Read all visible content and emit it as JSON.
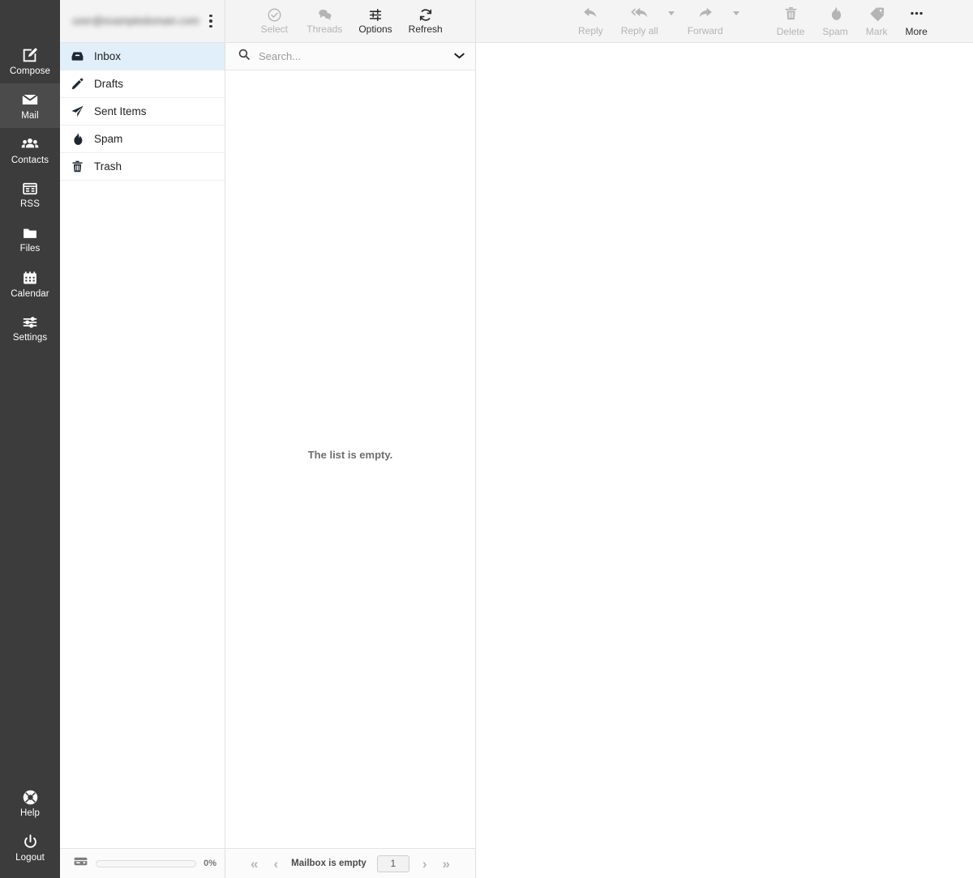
{
  "taskbar": {
    "items": [
      {
        "label": "Compose",
        "icon": "compose-icon",
        "selected": false
      },
      {
        "label": "Mail",
        "icon": "mail-icon",
        "selected": true
      },
      {
        "label": "Contacts",
        "icon": "contacts-icon",
        "selected": false
      },
      {
        "label": "RSS",
        "icon": "rss-icon",
        "selected": false
      },
      {
        "label": "Files",
        "icon": "files-icon",
        "selected": false
      },
      {
        "label": "Calendar",
        "icon": "calendar-icon",
        "selected": false
      },
      {
        "label": "Settings",
        "icon": "settings-icon",
        "selected": false
      }
    ],
    "bottom_items": [
      {
        "label": "Help",
        "icon": "help-icon"
      },
      {
        "label": "Logout",
        "icon": "logout-icon"
      }
    ]
  },
  "folders": {
    "account_name": "user@exampledomain.com",
    "menu_icon": "kebab-menu-icon",
    "items": [
      {
        "label": "Inbox",
        "icon": "inbox-icon",
        "active": true
      },
      {
        "label": "Drafts",
        "icon": "pencil-icon",
        "active": false
      },
      {
        "label": "Sent Items",
        "icon": "paper-plane-icon",
        "active": false
      },
      {
        "label": "Spam",
        "icon": "flame-icon",
        "active": false
      },
      {
        "label": "Trash",
        "icon": "trash-icon",
        "active": false
      }
    ],
    "quota": {
      "icon": "disk-icon",
      "percent_label": "0%",
      "percent_value": 0
    }
  },
  "list_toolbar": {
    "buttons": [
      {
        "label": "Select",
        "icon": "check-circle-icon",
        "enabled": false
      },
      {
        "label": "Threads",
        "icon": "threads-icon",
        "enabled": false
      },
      {
        "label": "Options",
        "icon": "options-icon",
        "enabled": true
      },
      {
        "label": "Refresh",
        "icon": "refresh-icon",
        "enabled": true
      }
    ]
  },
  "search": {
    "icon": "search-icon",
    "placeholder": "Search...",
    "value": "",
    "dropdown_icon": "chevron-down-icon"
  },
  "message_list": {
    "empty_text": "The list is empty."
  },
  "pager": {
    "first_icon": "double-chevron-left-icon",
    "prev_icon": "chevron-left-icon",
    "status": "Mailbox is empty",
    "page_value": "1",
    "next_icon": "chevron-right-icon",
    "last_icon": "double-chevron-right-icon"
  },
  "view_toolbar": {
    "buttons": [
      {
        "label": "Reply",
        "icon": "reply-icon",
        "enabled": false,
        "caret": false
      },
      {
        "label": "Reply all",
        "icon": "reply-all-icon",
        "enabled": false,
        "caret": true
      },
      {
        "label": "Forward",
        "icon": "forward-icon",
        "enabled": false,
        "caret": true
      },
      {
        "label": "Delete",
        "icon": "trash-icon",
        "enabled": false,
        "caret": false
      },
      {
        "label": "Spam",
        "icon": "flame-icon",
        "enabled": false,
        "caret": false
      },
      {
        "label": "Mark",
        "icon": "tag-icon",
        "enabled": false,
        "caret": false
      },
      {
        "label": "More",
        "icon": "ellipsis-icon",
        "enabled": true,
        "caret": false
      }
    ]
  },
  "colors": {
    "taskbar_bg": "#3c3c3c",
    "taskbar_selected": "#4b4b4b",
    "toolbar_bg": "#f4f4f4",
    "folder_active": "#e1effa",
    "disabled_text": "#b4b4b4",
    "enabled_text": "#2b2b2b"
  }
}
